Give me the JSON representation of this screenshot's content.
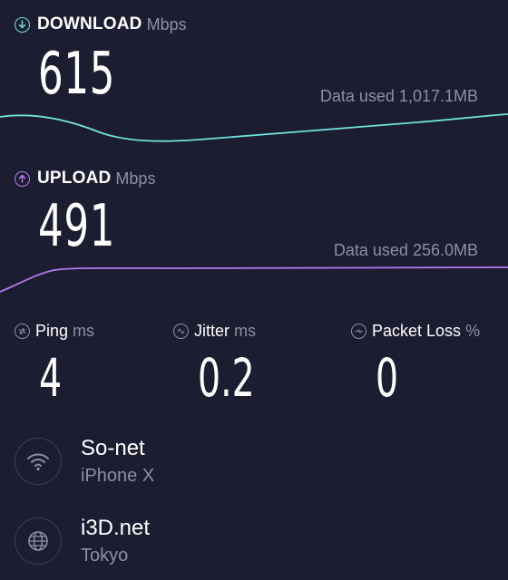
{
  "download": {
    "title": "DOWNLOAD",
    "unit": "Mbps",
    "value": "615",
    "data_used": "Data used 1,017.1MB",
    "icon": "arrow-down-circle-icon",
    "color": "#6fe2db"
  },
  "upload": {
    "title": "UPLOAD",
    "unit": "Mbps",
    "value": "491",
    "data_used": "Data used 256.0MB",
    "icon": "arrow-up-circle-icon",
    "color": "#b57af2"
  },
  "ping": {
    "title": "Ping",
    "unit": "ms",
    "value": "4",
    "icon": "ping-icon"
  },
  "jitter": {
    "title": "Jitter",
    "unit": "ms",
    "value": "0.2",
    "icon": "jitter-icon"
  },
  "packet_loss": {
    "title": "Packet Loss",
    "unit": "%",
    "value": "0",
    "icon": "packet-loss-icon"
  },
  "connection": {
    "name": "So-net",
    "device": "iPhone X",
    "icon": "wifi-icon"
  },
  "server": {
    "name": "i3D.net",
    "location": "Tokyo",
    "icon": "globe-icon"
  }
}
